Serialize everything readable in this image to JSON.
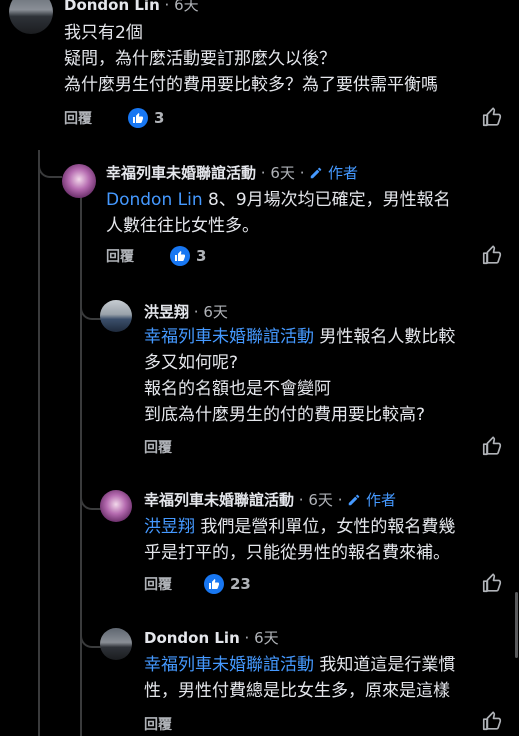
{
  "comments": [
    {
      "author": "Dondon Lin",
      "time": "6天",
      "lines": [
        "我只有2個",
        "疑問，為什麼活動要訂那麼久以後？",
        "為什麼男生付的費用要比較多？為了要供需平衡嗎"
      ],
      "reply_label": "回覆",
      "likes": "3"
    },
    {
      "author": "幸福列車未婚聯誼活動",
      "time": "6天",
      "badge": "作者",
      "mention": "Dondon Lin",
      "lines": [
        "8、9月場次均已確定，男性報名",
        "人數往往比女性多。"
      ],
      "reply_label": "回覆",
      "likes": "3"
    },
    {
      "author": "洪昱翔",
      "time": "6天",
      "mention": "幸福列車未婚聯誼活動",
      "lines": [
        "男性報名人數比較",
        "多又如何呢?",
        "報名的名額也是不會變阿",
        "到底為什麼男生的付的費用要比較高?"
      ],
      "reply_label": "回覆"
    },
    {
      "author": "幸福列車未婚聯誼活動",
      "time": "6天",
      "badge": "作者",
      "mention": "洪昱翔",
      "lines": [
        "我們是營利單位，女性的報名費幾",
        "乎是打平的，只能從男性的報名費來補。"
      ],
      "reply_label": "回覆",
      "likes": "23"
    },
    {
      "author": "Dondon Lin",
      "time": "6天",
      "mention": "幸福列車未婚聯誼活動",
      "lines": [
        "我知道這是行業慣",
        "性，男性付費總是比女生多，原來是這樣"
      ],
      "reply_label": "回覆"
    }
  ],
  "separator": "·",
  "icons": {
    "like": "thumbs-up-icon",
    "author_badge": "pencil-icon"
  },
  "colors": {
    "background": "#000000",
    "text": "#e4e6eb",
    "muted": "#b0b3b8",
    "link": "#4599ff",
    "like_blue": "#1877f2"
  }
}
